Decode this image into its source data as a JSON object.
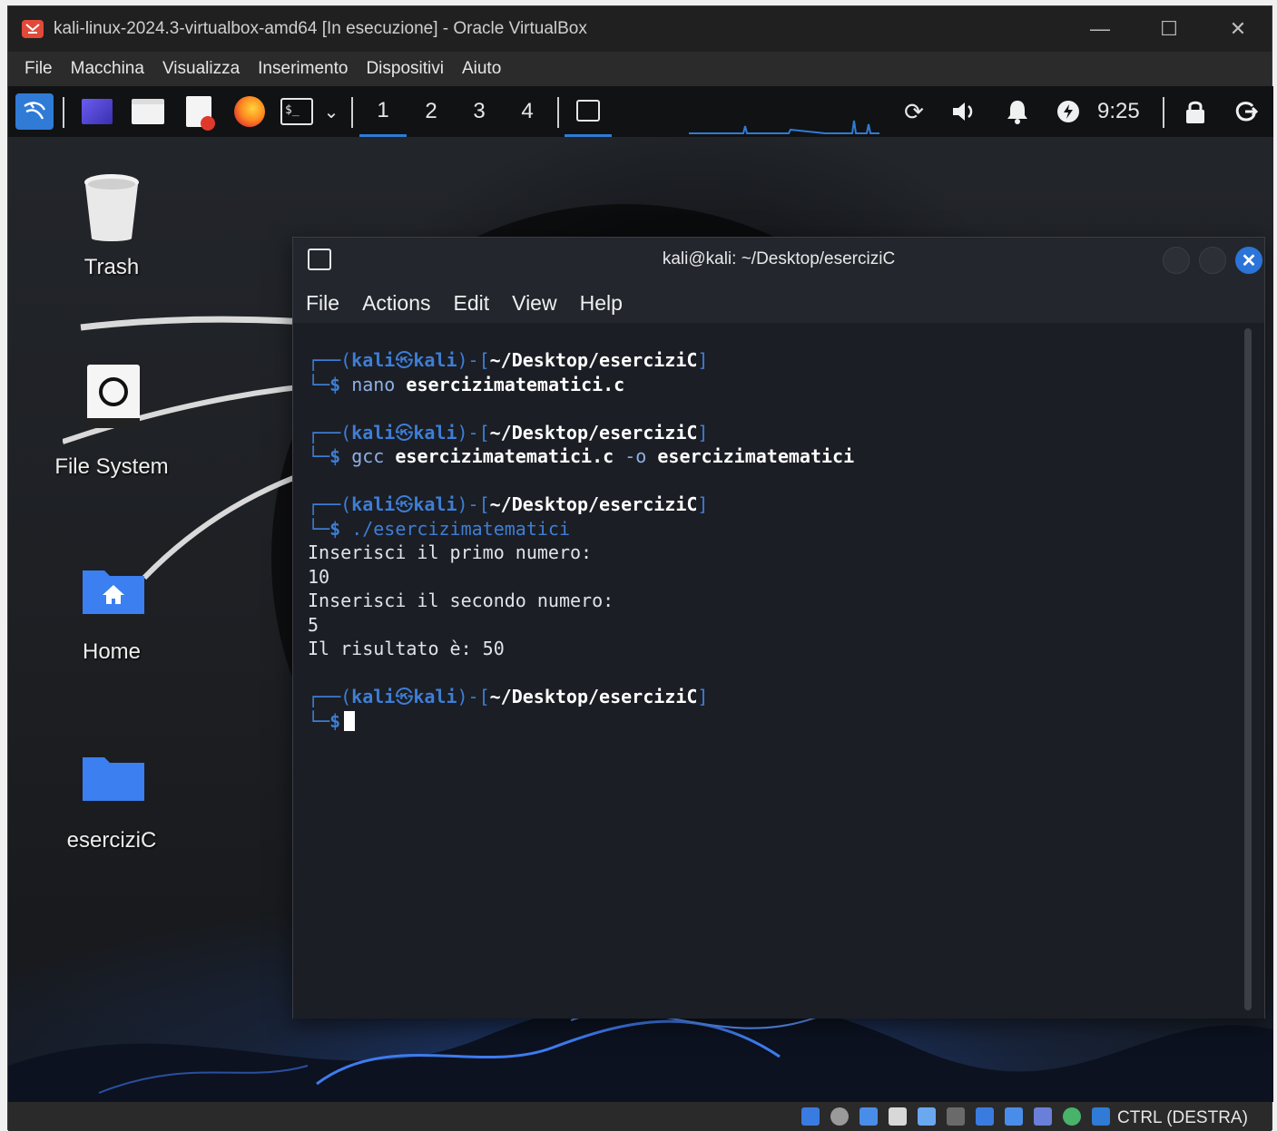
{
  "vbox": {
    "title": "kali-linux-2024.3-virtualbox-amd64 [In esecuzione] - Oracle VirtualBox",
    "menu": [
      "File",
      "Macchina",
      "Visualizza",
      "Inserimento",
      "Dispositivi",
      "Aiuto"
    ],
    "status_text": "CTRL (DESTRA)"
  },
  "panel": {
    "workspaces": [
      "1",
      "2",
      "3",
      "4"
    ],
    "active_workspace": "1",
    "clock": "9:25"
  },
  "desktop": {
    "icons": [
      {
        "label": "Trash",
        "icon": "trash-icon"
      },
      {
        "label": "File System",
        "icon": "drive-icon"
      },
      {
        "label": "Home",
        "icon": "home-folder-icon"
      },
      {
        "label": "eserciziC",
        "icon": "folder-icon"
      }
    ]
  },
  "terminal": {
    "title": "kali@kali: ~/Desktop/eserciziC",
    "menu": [
      "File",
      "Actions",
      "Edit",
      "View",
      "Help"
    ],
    "prompt": {
      "user": "kali",
      "at": "㉿",
      "host": "kali",
      "path": "~/Desktop/eserciziC",
      "dollar": "$"
    },
    "commands": [
      {
        "cmd": "nano",
        "args": "esercizimatematici.c"
      },
      {
        "cmd": "gcc",
        "args": "esercizimatematici.c",
        "flag": "-o",
        "out": "esercizimatematici"
      },
      {
        "cmd": "./esercizimatematici"
      }
    ],
    "output": [
      "Inserisci il primo numero:",
      "10",
      "Inserisci il secondo numero:",
      "5",
      "Il risultato è: 50"
    ]
  },
  "colors": {
    "accent": "#2f7bd6",
    "prompt_blue": "#3e7ed6",
    "terminal_bg": "#1b1e24"
  }
}
